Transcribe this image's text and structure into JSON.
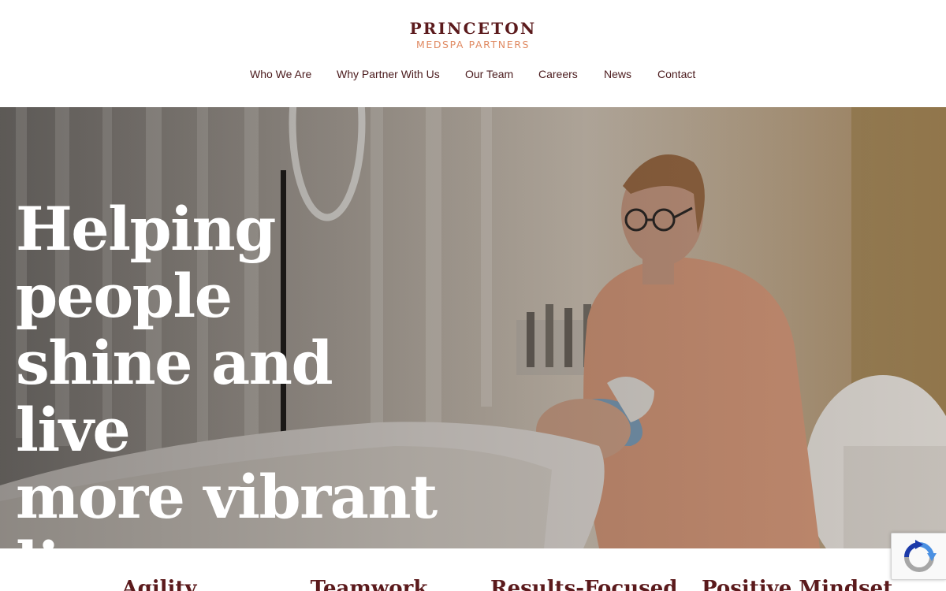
{
  "brand": {
    "name": "PRINCETON",
    "tagline": "MEDSPA PARTNERS",
    "primary_color": "#5b1a1c",
    "accent_color": "#e08a62"
  },
  "nav": {
    "items": [
      {
        "label": "Who We Are"
      },
      {
        "label": "Why Partner With Us"
      },
      {
        "label": "Our Team"
      },
      {
        "label": "Careers"
      },
      {
        "label": "News"
      },
      {
        "label": "Contact"
      }
    ]
  },
  "hero": {
    "headline_lines": [
      "Helping people",
      "shine and live",
      "more vibrant",
      "lives."
    ],
    "image": "photo of aesthetician performing a facial treatment on a client"
  },
  "values": {
    "items": [
      {
        "title": "Agility"
      },
      {
        "title": "Teamwork"
      },
      {
        "title": "Results-Focused"
      },
      {
        "title": "Positive Mindset"
      }
    ]
  },
  "recaptcha": {
    "icon": "recaptcha-icon"
  }
}
